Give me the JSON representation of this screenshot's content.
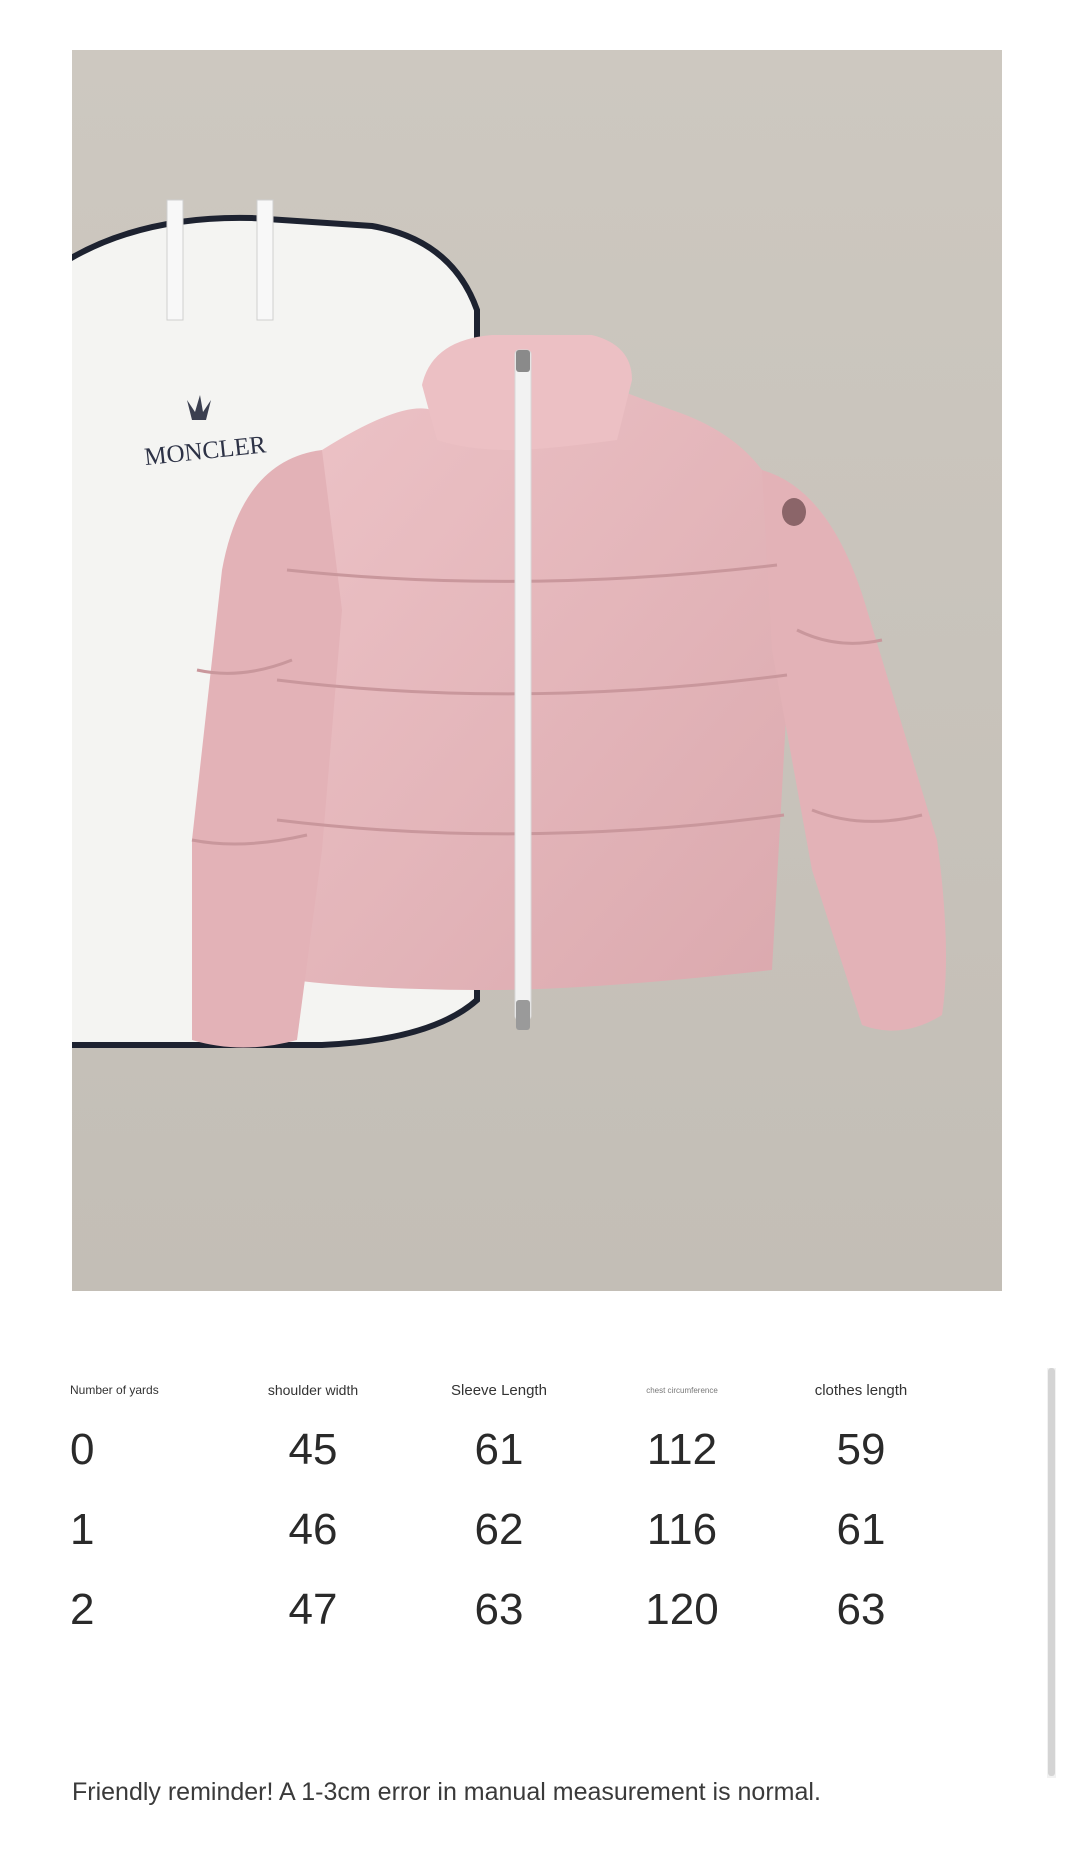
{
  "photo": {
    "brand_text": "MONCLER",
    "colors": {
      "background": "#c9c4bc",
      "garment_bag": "#f4f4f2",
      "jacket": "#e6b9bd",
      "zipper": "#f2f2f2"
    }
  },
  "size_chart": {
    "headers": [
      "Number of yards",
      "shoulder width",
      "Sleeve Length",
      "chest circumference",
      "clothes length"
    ],
    "rows": [
      [
        "0",
        "45",
        "61",
        "112",
        "59"
      ],
      [
        "1",
        "46",
        "62",
        "116",
        "61"
      ],
      [
        "2",
        "47",
        "63",
        "120",
        "63"
      ]
    ]
  },
  "reminder": "Friendly reminder! A 1-3cm error in manual measurement is normal."
}
